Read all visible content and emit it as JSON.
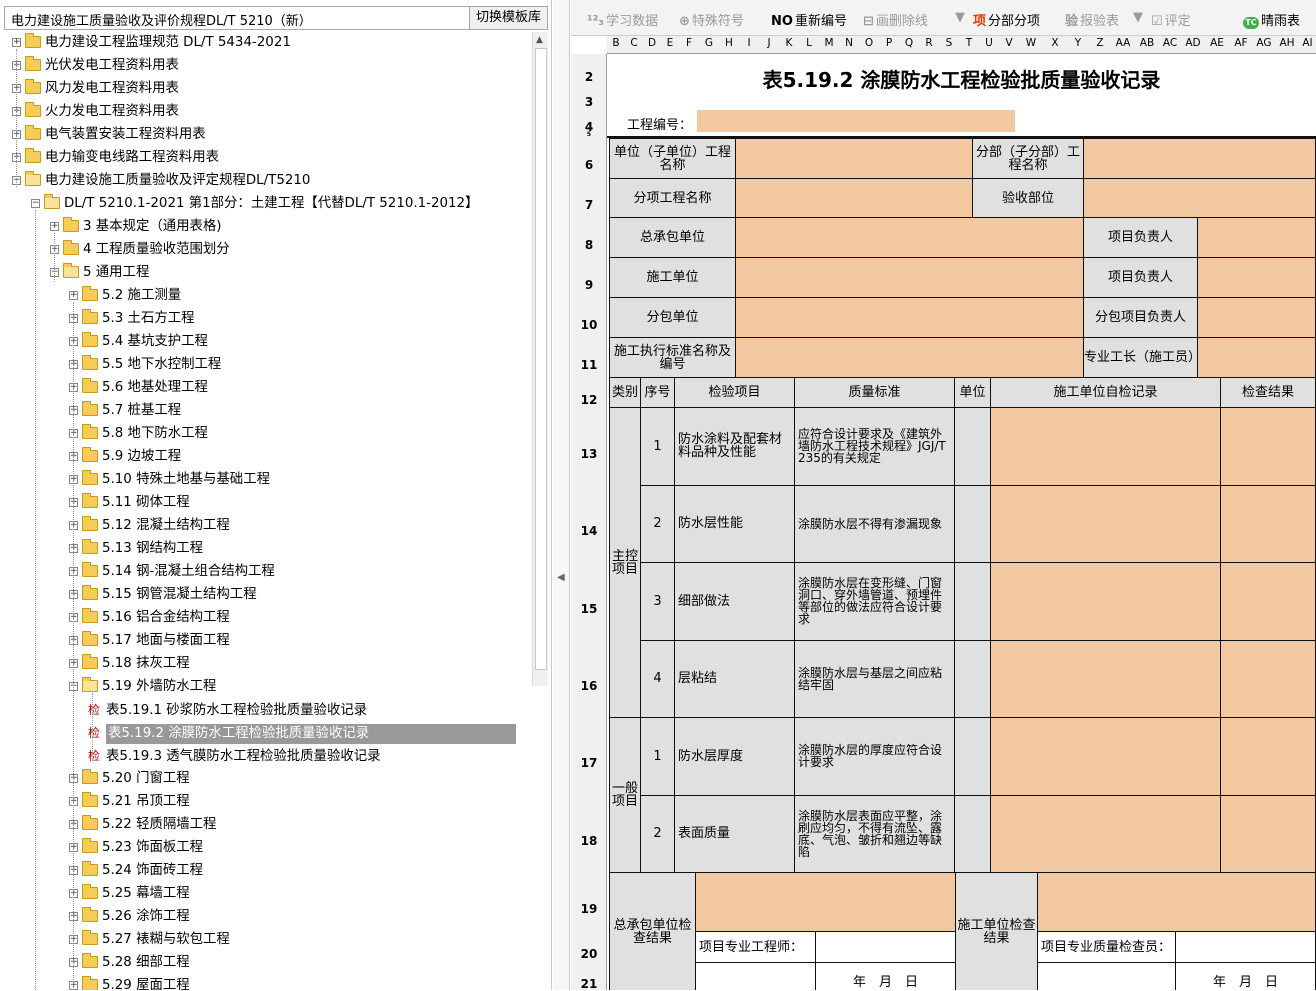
{
  "left": {
    "template_select": "电力建设施工质量验收及评价规程DL/T 5210（新）",
    "switch_button": "切换模板库",
    "tree": [
      {
        "label": "电力建设工程监理规范 DL/T 5434-2021",
        "level": 0,
        "exp": "+",
        "type": "folder"
      },
      {
        "label": "光伏发电工程资料用表",
        "level": 0,
        "exp": "+",
        "type": "folder"
      },
      {
        "label": "风力发电工程资料用表",
        "level": 0,
        "exp": "+",
        "type": "folder"
      },
      {
        "label": "火力发电工程资料用表",
        "level": 0,
        "exp": "+",
        "type": "folder"
      },
      {
        "label": "电气装置安装工程资料用表",
        "level": 0,
        "exp": "+",
        "type": "folder"
      },
      {
        "label": "电力输变电线路工程资料用表",
        "level": 0,
        "exp": "+",
        "type": "folder"
      },
      {
        "label": "电力建设施工质量验收及评定规程DL/T5210",
        "level": 0,
        "exp": "-",
        "type": "open"
      },
      {
        "label": "DL/T 5210.1-2021 第1部分：土建工程【代替DL/T 5210.1-2012】",
        "level": 1,
        "exp": "-",
        "type": "open"
      },
      {
        "label": "3 基本规定（通用表格)",
        "level": 2,
        "exp": "+",
        "type": "folder"
      },
      {
        "label": "4 工程质量验收范围划分",
        "level": 2,
        "exp": "+",
        "type": "folder"
      },
      {
        "label": "5 通用工程",
        "level": 2,
        "exp": "-",
        "type": "open"
      },
      {
        "label": "5.2 施工测量",
        "level": 3,
        "exp": "+",
        "type": "folder"
      },
      {
        "label": "5.3 土石方工程",
        "level": 3,
        "exp": "+",
        "type": "folder"
      },
      {
        "label": "5.4 基坑支护工程",
        "level": 3,
        "exp": "+",
        "type": "folder"
      },
      {
        "label": "5.5 地下水控制工程",
        "level": 3,
        "exp": "+",
        "type": "folder"
      },
      {
        "label": "5.6 地基处理工程",
        "level": 3,
        "exp": "+",
        "type": "folder"
      },
      {
        "label": "5.7 桩基工程",
        "level": 3,
        "exp": "+",
        "type": "folder"
      },
      {
        "label": "5.8 地下防水工程",
        "level": 3,
        "exp": "+",
        "type": "folder"
      },
      {
        "label": "5.9 边坡工程",
        "level": 3,
        "exp": "+",
        "type": "folder"
      },
      {
        "label": "5.10 特殊土地基与基础工程",
        "level": 3,
        "exp": "+",
        "type": "folder"
      },
      {
        "label": "5.11 砌体工程",
        "level": 3,
        "exp": "+",
        "type": "folder"
      },
      {
        "label": "5.12 混凝土结构工程",
        "level": 3,
        "exp": "+",
        "type": "folder"
      },
      {
        "label": "5.13 钢结构工程",
        "level": 3,
        "exp": "+",
        "type": "folder"
      },
      {
        "label": "5.14 钢-混凝土组合结构工程",
        "level": 3,
        "exp": "+",
        "type": "folder"
      },
      {
        "label": "5.15 钢管混凝土结构工程",
        "level": 3,
        "exp": "+",
        "type": "folder"
      },
      {
        "label": "5.16 铝合金结构工程",
        "level": 3,
        "exp": "+",
        "type": "folder"
      },
      {
        "label": "5.17 地面与楼面工程",
        "level": 3,
        "exp": "+",
        "type": "folder"
      },
      {
        "label": "5.18 抹灰工程",
        "level": 3,
        "exp": "+",
        "type": "folder"
      },
      {
        "label": "5.19 外墙防水工程",
        "level": 3,
        "exp": "-",
        "type": "open"
      },
      {
        "label": "表5.19.1 砂浆防水工程检验批质量验收记录",
        "level": 4,
        "type": "doc"
      },
      {
        "label": "表5.19.2 涂膜防水工程检验批质量验收记录",
        "level": 4,
        "type": "doc",
        "selected": true
      },
      {
        "label": "表5.19.3 透气膜防水工程检验批质量验收记录",
        "level": 4,
        "type": "doc"
      },
      {
        "label": "5.20 门窗工程",
        "level": 3,
        "exp": "+",
        "type": "folder"
      },
      {
        "label": "5.21 吊顶工程",
        "level": 3,
        "exp": "+",
        "type": "folder"
      },
      {
        "label": "5.22 轻质隔墙工程",
        "level": 3,
        "exp": "+",
        "type": "folder"
      },
      {
        "label": "5.23 饰面板工程",
        "level": 3,
        "exp": "+",
        "type": "folder"
      },
      {
        "label": "5.24 饰面砖工程",
        "level": 3,
        "exp": "+",
        "type": "folder"
      },
      {
        "label": "5.25 幕墙工程",
        "level": 3,
        "exp": "+",
        "type": "folder"
      },
      {
        "label": "5.26 涂饰工程",
        "level": 3,
        "exp": "+",
        "type": "folder"
      },
      {
        "label": "5.27 裱糊与软包工程",
        "level": 3,
        "exp": "+",
        "type": "folder"
      },
      {
        "label": "5.28 细部工程",
        "level": 3,
        "exp": "+",
        "type": "folder"
      },
      {
        "label": "5.29 屋面工程",
        "level": 3,
        "exp": "+",
        "type": "folder"
      }
    ],
    "doc_marker": "检"
  },
  "toolbar": {
    "learn": "学习数据",
    "learn_icon": "¹²₃",
    "special": "特殊符号",
    "special_icon": "⊕",
    "renumber": "重新编号",
    "renumber_icon": "NO",
    "strike": "画删除线",
    "strike_icon": "⊟",
    "subitem": "分部分项",
    "subitem_icon": "项",
    "report": "报验表",
    "report_icon": "验",
    "rate": "评定",
    "rate_icon": "☑",
    "qingyu": "晴雨表",
    "qingyu_icon": "TC"
  },
  "columns": [
    "B",
    "C",
    "D",
    "E",
    "F",
    "G",
    "H",
    "I",
    "J",
    "K",
    "L",
    "M",
    "N",
    "O",
    "P",
    "Q",
    "R",
    "S",
    "T",
    "U",
    "V",
    "W",
    "X",
    "Y",
    "Z",
    "AA",
    "AB",
    "AC",
    "AD",
    "AE",
    "AF",
    "AG",
    "AH",
    "AI"
  ],
  "rows": [
    "2",
    "3",
    "4",
    "5",
    "6",
    "7",
    "8",
    "9",
    "10",
    "11",
    "12",
    "13",
    "14",
    "15",
    "16",
    "17",
    "18",
    "19",
    "20",
    "21"
  ],
  "form": {
    "title": "表5.19.2  涂膜防水工程检验批质量验收记录",
    "project_no_label": "工程编号：",
    "unit_name_label": "单位（子单位）工程名称",
    "sub_name_label": "分部（子分部）工程名称",
    "item_name_label": "分项工程名称",
    "check_part_label": "验收部位",
    "general_contractor_label": "总承包单位",
    "project_leader_label": "项目负责人",
    "construction_unit_label": "施工单位",
    "sub_unit_label": "分包单位",
    "sub_leader_label": "分包项目负责人",
    "standard_label": "施工执行标准名称及编号",
    "foreman_label": "专业工长（施工员）",
    "headers": {
      "category": "类别",
      "seq": "序号",
      "item": "检验项目",
      "standard": "质量标准",
      "unit": "单位",
      "self_check": "施工单位自检记录",
      "result": "检查结果"
    },
    "main_category": "主控项目",
    "general_category": "一般项目",
    "main_items": [
      {
        "seq": "1",
        "item": "防水涂料及配套材料品种及性能",
        "standard": "应符合设计要求及《建筑外墙防水工程技术规程》JGJ/T 235的有关规定"
      },
      {
        "seq": "2",
        "item": "防水层性能",
        "standard": "涂膜防水层不得有渗漏现象"
      },
      {
        "seq": "3",
        "item": "细部做法",
        "standard": "涂膜防水层在变形缝、门窗洞口、穿外墙管道、预埋件等部位的做法应符合设计要求"
      },
      {
        "seq": "4",
        "item": "层粘结",
        "standard": "涂膜防水层与基层之间应粘结牢固"
      }
    ],
    "general_items": [
      {
        "seq": "1",
        "item": "防水层厚度",
        "standard": "涂膜防水层的厚度应符合设计要求"
      },
      {
        "seq": "2",
        "item": "表面质量",
        "standard": "涂膜防水层表面应平整，涂刷应均匀，不得有流坠、露底、气泡、皱折和翘边等缺陷"
      }
    ],
    "gc_result_label": "总承包单位检查结果",
    "cu_result_label": "施工单位检查结果",
    "engineer_label": "项目专业工程师：",
    "inspector_label": "项目专业质量检查员：",
    "date_label": "年　月　日"
  },
  "colors": {
    "input_fill": "#f2c8a1",
    "label_fill": "#e0e0e0",
    "selected": "#999999"
  }
}
